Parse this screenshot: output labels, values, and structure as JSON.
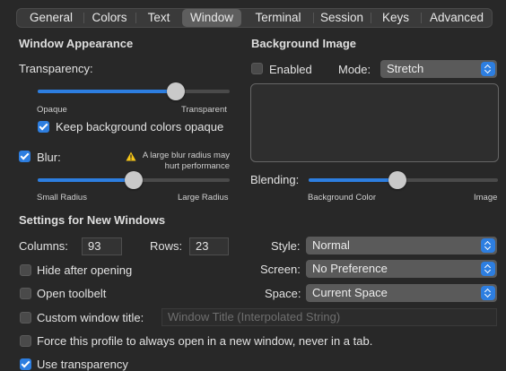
{
  "tabs": [
    "General",
    "Colors",
    "Text",
    "Window",
    "Terminal",
    "Session",
    "Keys",
    "Advanced"
  ],
  "selected_tab": "Window",
  "window_appearance": {
    "heading": "Window Appearance",
    "transparency_label": "Transparency:",
    "transparency_min_label": "Opaque",
    "transparency_max_label": "Transparent",
    "transparency_value": 0.72,
    "keep_bg_opaque_label": "Keep background colors opaque",
    "keep_bg_opaque_checked": true,
    "blur_label": "Blur:",
    "blur_checked": true,
    "blur_warning": "A large blur radius may\nhurt performance",
    "blur_min_label": "Small Radius",
    "blur_max_label": "Large Radius",
    "blur_value": 0.5
  },
  "background_image": {
    "heading": "Background Image",
    "enabled_label": "Enabled",
    "enabled_checked": false,
    "mode_label": "Mode:",
    "mode_value": "Stretch",
    "blending_label": "Blending:",
    "blending_min_label": "Background Color",
    "blending_max_label": "Image",
    "blending_value": 0.47
  },
  "new_windows": {
    "heading": "Settings for New Windows",
    "columns_label": "Columns:",
    "columns_value": "93",
    "rows_label": "Rows:",
    "rows_value": "23",
    "style_label": "Style:",
    "style_value": "Normal",
    "screen_label": "Screen:",
    "screen_value": "No Preference",
    "space_label": "Space:",
    "space_value": "Current Space",
    "hide_after_opening_label": "Hide after opening",
    "open_toolbelt_label": "Open toolbelt",
    "custom_title_label": "Custom window title:",
    "custom_title_placeholder": "Window Title (Interpolated String)",
    "force_new_window_label": "Force this profile to always open in a new window, never in a tab.",
    "use_transparency_label": "Use transparency",
    "use_transparency_checked": true
  },
  "colors": {
    "accent": "#2d7ee0",
    "background": "#282828",
    "warning": "#f5c518"
  }
}
